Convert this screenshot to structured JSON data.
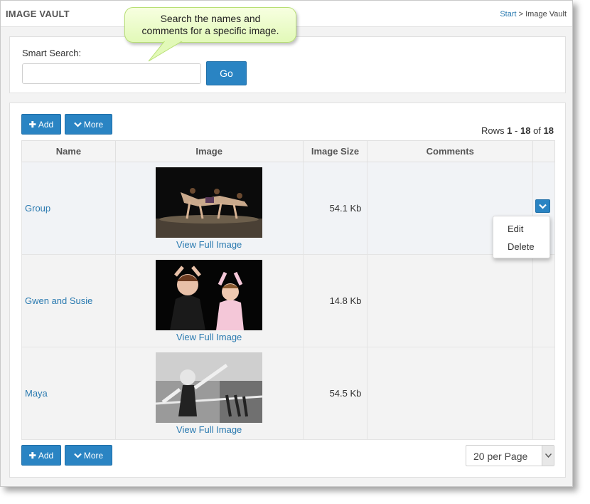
{
  "header": {
    "title": "IMAGE VAULT",
    "breadcrumb_start": "Start",
    "breadcrumb_sep": ">",
    "breadcrumb_current": "Image Vault"
  },
  "callout": {
    "line1": "Search the names and",
    "line2": "comments for a specific image."
  },
  "search": {
    "label": "Smart Search:",
    "value": "",
    "placeholder": "",
    "go_label": "Go"
  },
  "toolbar": {
    "add_label": "Add",
    "more_label": "More"
  },
  "rows_info": {
    "prefix": "Rows",
    "from": "1",
    "dash": "-",
    "to": "18",
    "of": "of",
    "total": "18"
  },
  "table": {
    "columns": [
      "Name",
      "Image",
      "Image Size",
      "Comments",
      ""
    ],
    "rows": [
      {
        "name": "Group",
        "view_label": "View Full Image",
        "size": "54.1 Kb",
        "comments": ""
      },
      {
        "name": "Gwen and Susie",
        "view_label": "View Full Image",
        "size": "14.8 Kb",
        "comments": ""
      },
      {
        "name": "Maya",
        "view_label": "View Full Image",
        "size": "54.5 Kb",
        "comments": ""
      }
    ]
  },
  "row_menu": {
    "items": [
      "Edit",
      "Delete"
    ]
  },
  "pagination": {
    "per_page": "20 per Page"
  },
  "colors": {
    "accent": "#2a84c3",
    "link": "#2a7ab0",
    "callout_bg": "#e2f9b8"
  },
  "icons": {
    "add": "plus-icon",
    "more": "chevron-down-icon",
    "row_action": "chevron-down-icon",
    "select": "caret-down-icon"
  }
}
